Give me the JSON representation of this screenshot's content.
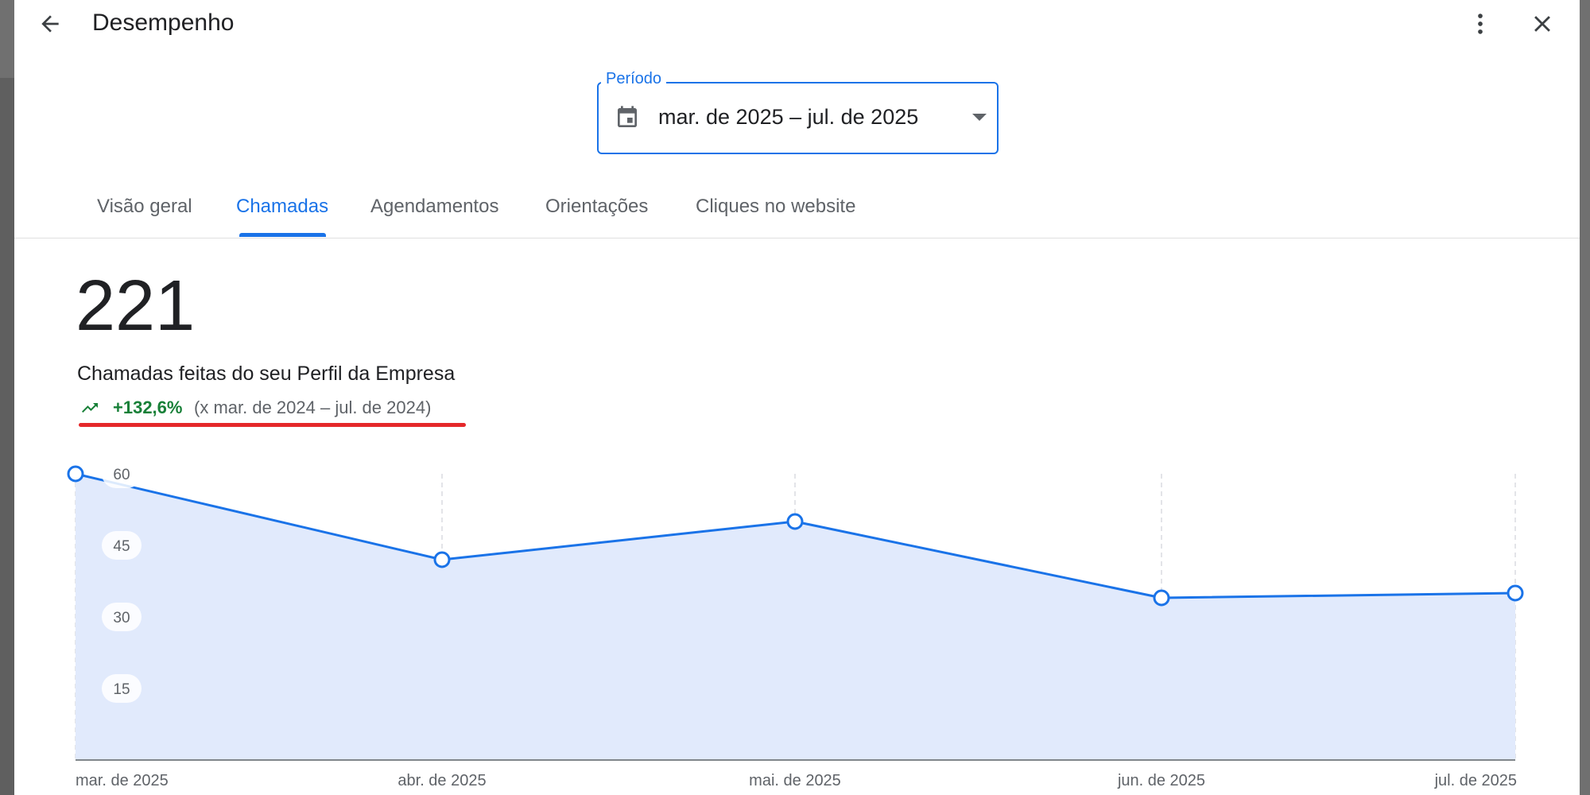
{
  "header": {
    "title": "Desempenho",
    "back_icon": "arrow-back-icon",
    "more_icon": "more-vert-icon",
    "close_icon": "close-icon"
  },
  "period": {
    "label": "Período",
    "value": "mar. de 2025 – jul. de 2025",
    "icon": "calendar-icon"
  },
  "tabs": [
    {
      "label": "Visão geral",
      "active": false
    },
    {
      "label": "Chamadas",
      "active": true
    },
    {
      "label": "Agendamentos",
      "active": false
    },
    {
      "label": "Orientações",
      "active": false
    },
    {
      "label": "Cliques no website",
      "active": false
    }
  ],
  "summary": {
    "total": "221",
    "description": "Chamadas feitas do seu Perfil da Empresa",
    "change": "+132,6%",
    "comparison": "(x mar. de 2024 – jul. de 2024)"
  },
  "colors": {
    "accent": "#1a73e8",
    "positive": "#188038",
    "annotation": "#e5282a",
    "area_fill": "#e1eafc"
  },
  "chart_data": {
    "type": "area",
    "categories": [
      "mar. de 2025",
      "abr. de 2025",
      "mai. de 2025",
      "jun. de 2025",
      "jul. de 2025"
    ],
    "values": [
      60,
      42,
      50,
      34,
      35
    ],
    "ylim": [
      0,
      60
    ],
    "yticks": [
      "15",
      "30",
      "45",
      "60"
    ],
    "grid": "vertical-dashed",
    "markers": "hollow-circle"
  }
}
